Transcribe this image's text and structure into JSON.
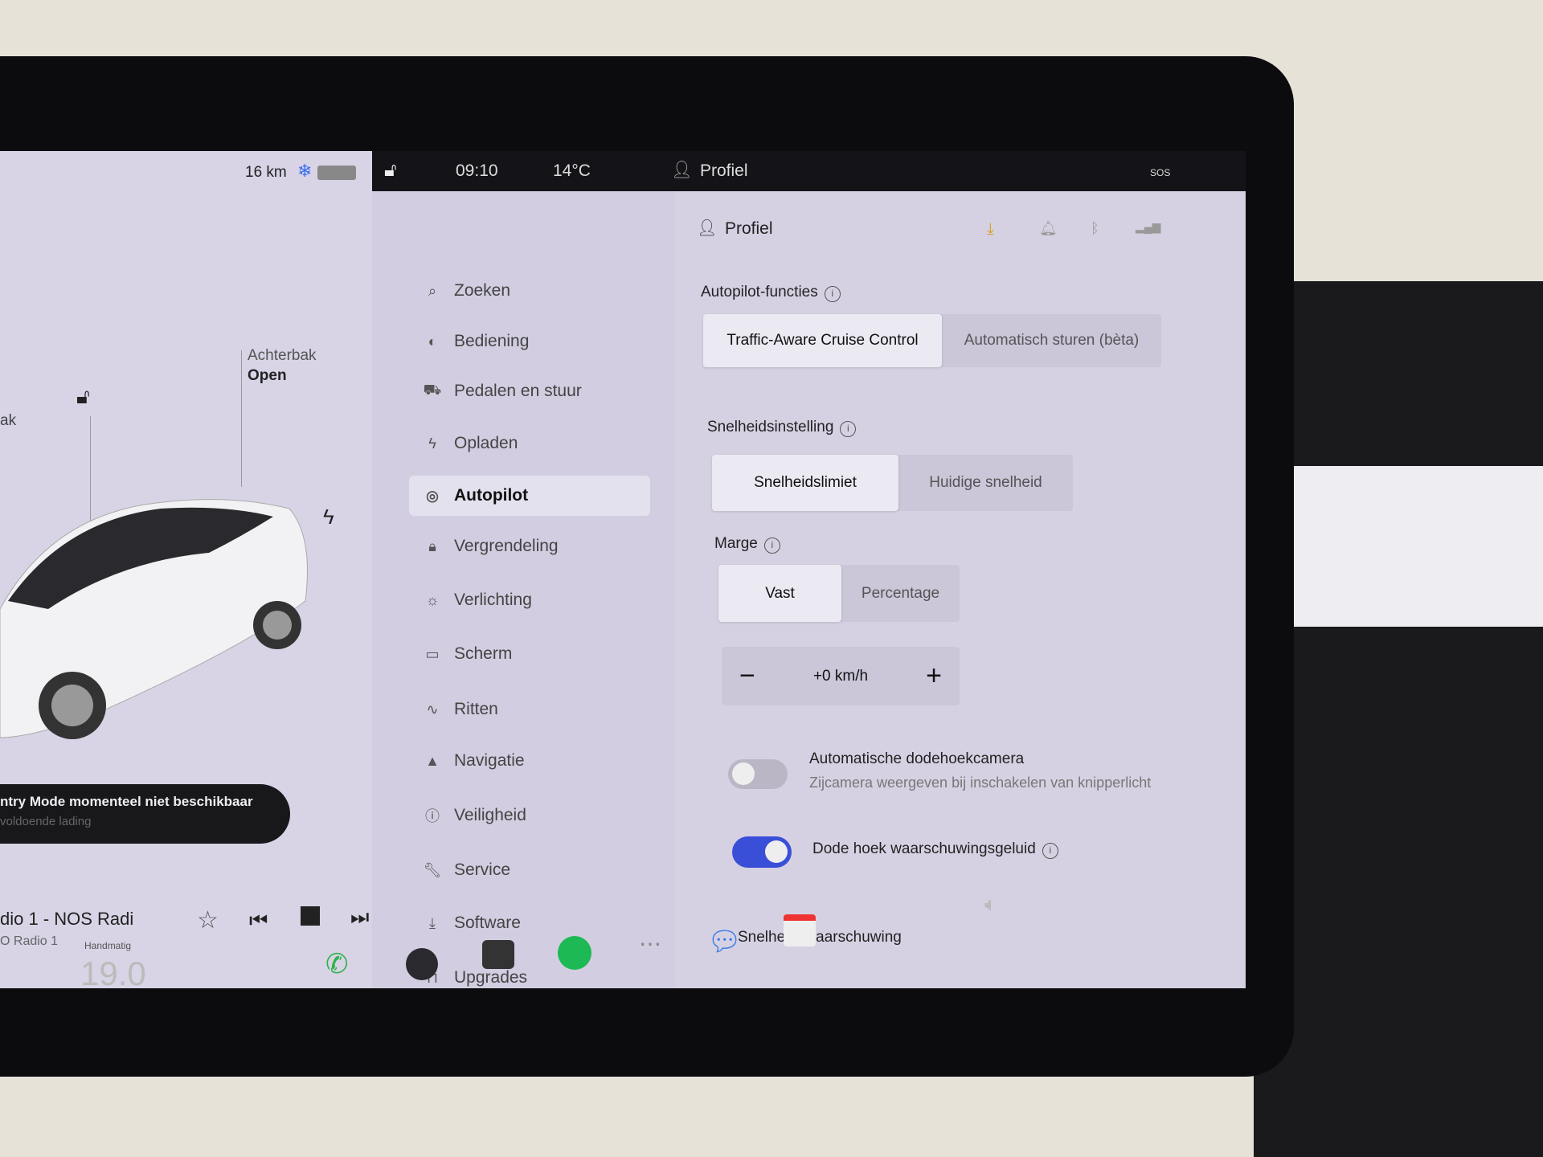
{
  "statusbar": {
    "range": "16 km",
    "time": "09:10",
    "temperature": "14°C",
    "profile": "Profiel",
    "sos": "SOS"
  },
  "car": {
    "frunk_partial": "ak",
    "trunk_label": "Achterbak",
    "trunk_state": "Open",
    "sentry_title": "ntry Mode momenteel niet beschikbaar",
    "sentry_sub": "voldoende lading"
  },
  "media": {
    "title": "dio 1 - NOS Radi",
    "subtitle": "O Radio 1"
  },
  "menu": {
    "items": [
      {
        "label": "Zoeken",
        "icon": "search-icon",
        "glyph": "⌕"
      },
      {
        "label": "Bediening",
        "icon": "toggle-icon",
        "glyph": "◐"
      },
      {
        "label": "Pedalen en stuur",
        "icon": "car-icon",
        "glyph": "⛟"
      },
      {
        "label": "Opladen",
        "icon": "bolt-icon",
        "glyph": "ϟ"
      },
      {
        "label": "Autopilot",
        "icon": "steering-wheel-icon",
        "glyph": "◎"
      },
      {
        "label": "Vergrendeling",
        "icon": "lock-icon",
        "glyph": "🔒︎"
      },
      {
        "label": "Verlichting",
        "icon": "light-icon",
        "glyph": "☼"
      },
      {
        "label": "Scherm",
        "icon": "display-icon",
        "glyph": "▭"
      },
      {
        "label": "Ritten",
        "icon": "trips-icon",
        "glyph": "∿"
      },
      {
        "label": "Navigatie",
        "icon": "navigation-icon",
        "glyph": "▲"
      },
      {
        "label": "Veiligheid",
        "icon": "safety-icon",
        "glyph": "ⓘ"
      },
      {
        "label": "Service",
        "icon": "wrench-icon",
        "glyph": "🔧︎"
      },
      {
        "label": "Software",
        "icon": "download-icon",
        "glyph": "⤓"
      },
      {
        "label": "Upgrades",
        "icon": "bag-icon",
        "glyph": "⊓"
      }
    ],
    "active": "Autopilot"
  },
  "content": {
    "profile": "Profiel",
    "autopilot_label": "Autopilot-functies",
    "autopilot_options": [
      "Traffic-Aware Cruise Control",
      "Automatisch sturen (bèta)"
    ],
    "speed_label": "Snelheidsinstelling",
    "speed_options": [
      "Snelheidslimiet",
      "Huidige snelheid"
    ],
    "margin_label": "Marge",
    "margin_options": [
      "Vast",
      "Percentage"
    ],
    "offset": "+0 km/h",
    "minus": "−",
    "plus": "+",
    "blindspot_cam": {
      "title": "Automatische dodehoekcamera",
      "sub": "Zijcamera weergeven bij inschakelen van knipperlicht",
      "on": false
    },
    "blindspot_chime": {
      "title": "Dode hoek waarschuwingsgeluid",
      "on": true
    },
    "speed_warning": "Snelheidswaarschuwing"
  },
  "climate": {
    "mode": "Handmatig",
    "temp": "19.0"
  },
  "colors": {
    "toggle_on": "#3a4fd8",
    "phone": "#2fb34a",
    "spotify": "#1db954"
  }
}
